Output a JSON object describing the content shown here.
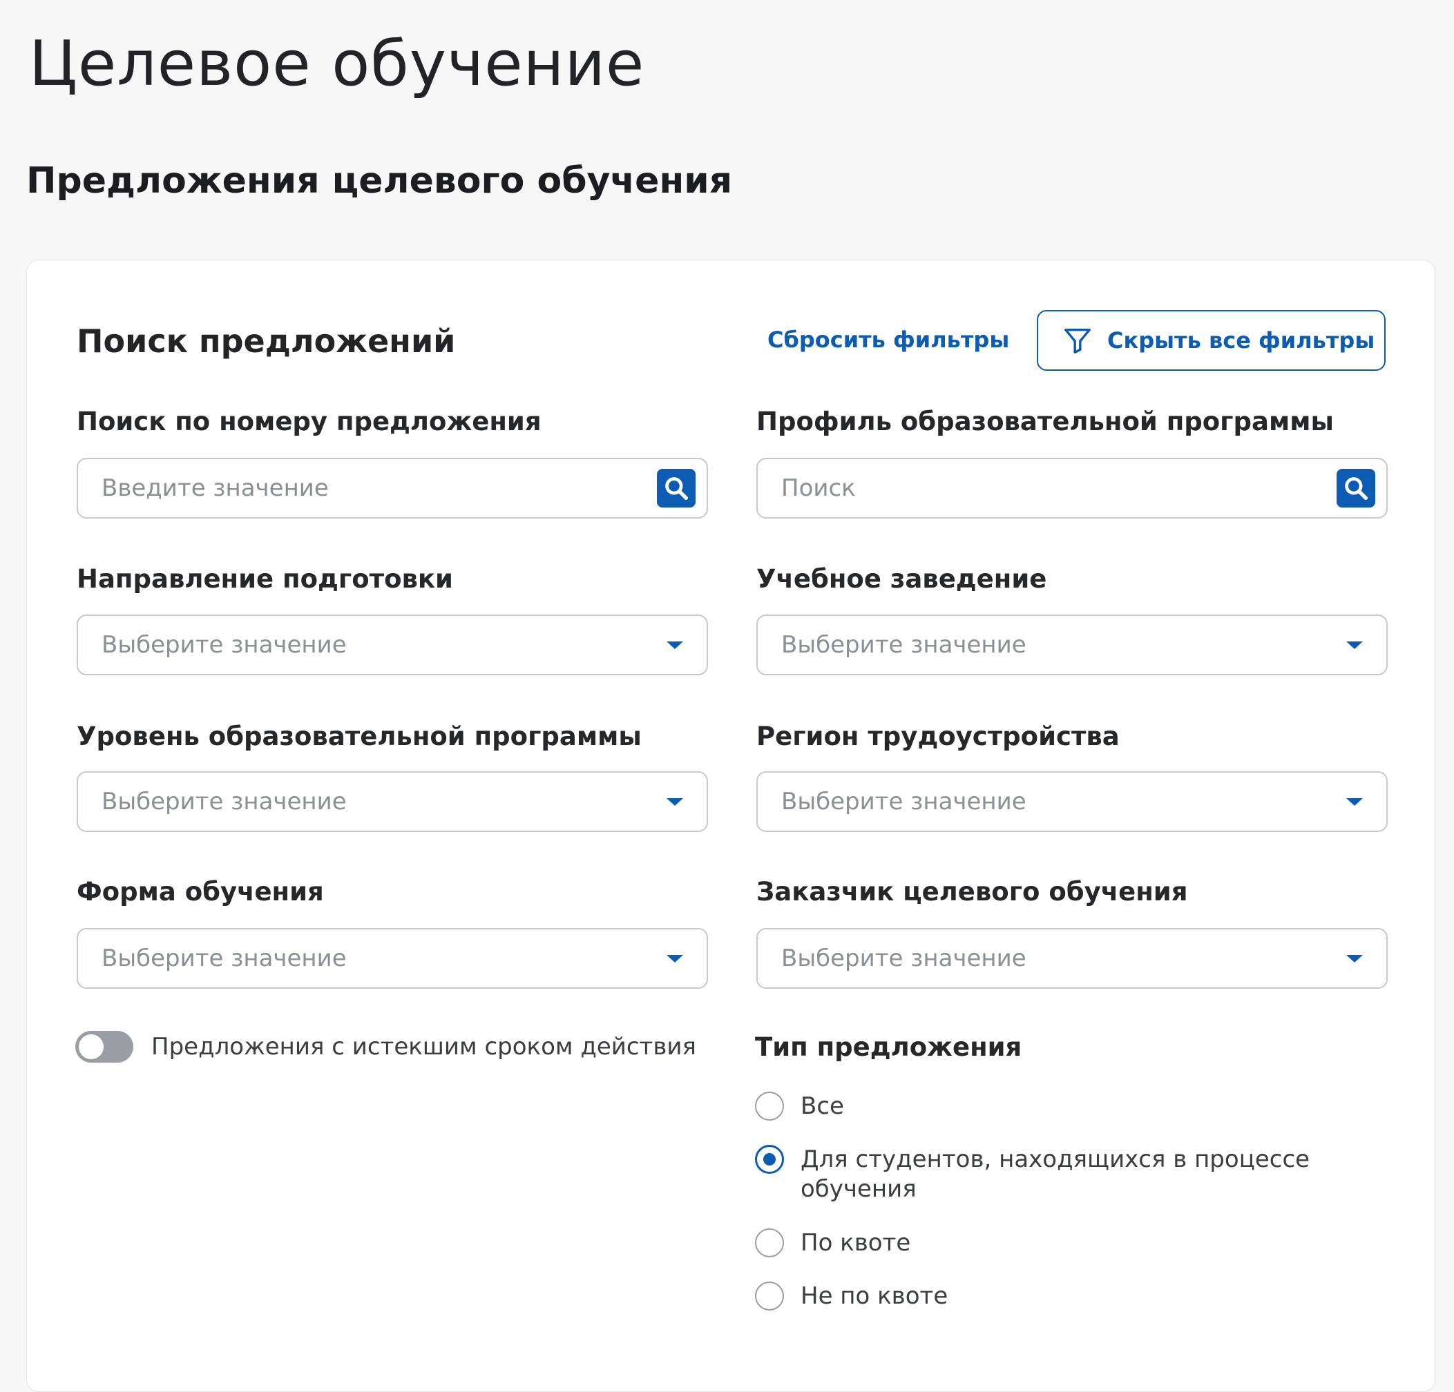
{
  "page": {
    "title": "Целевое обучение",
    "section_title": "Предложения целевого обучения"
  },
  "search_card": {
    "title": "Поиск предложений",
    "reset_label": "Сбросить фильтры",
    "hide_filters_label": "Скрыть все фильтры"
  },
  "fields": {
    "offer_number": {
      "label": "Поиск по номеру предложения",
      "placeholder": "Введите значение"
    },
    "program_profile": {
      "label": "Профиль образовательной программы",
      "placeholder": "Поиск"
    },
    "training_direction": {
      "label": "Направление подготовки",
      "placeholder": "Выберите значение"
    },
    "institution": {
      "label": "Учебное заведение",
      "placeholder": "Выберите значение"
    },
    "program_level": {
      "label": "Уровень образовательной программы",
      "placeholder": "Выберите значение"
    },
    "employment_region": {
      "label": "Регион трудоустройства",
      "placeholder": "Выберите значение"
    },
    "study_form": {
      "label": "Форма обучения",
      "placeholder": "Выберите значение"
    },
    "customer": {
      "label": "Заказчик целевого обучения",
      "placeholder": "Выберите значение"
    }
  },
  "expired_toggle": {
    "label": "Предложения с истекшим сроком действия",
    "on": false
  },
  "offer_type": {
    "title": "Тип предложения",
    "options": [
      {
        "label": "Все",
        "checked": false
      },
      {
        "label": "Для студентов, находящихся в процессе обучения",
        "checked": true
      },
      {
        "label": "По квоте",
        "checked": false
      },
      {
        "label": "Не по квоте",
        "checked": false
      }
    ]
  },
  "colors": {
    "accent": "#0d5cb3",
    "background": "#f7f7f8",
    "card": "#ffffff"
  }
}
